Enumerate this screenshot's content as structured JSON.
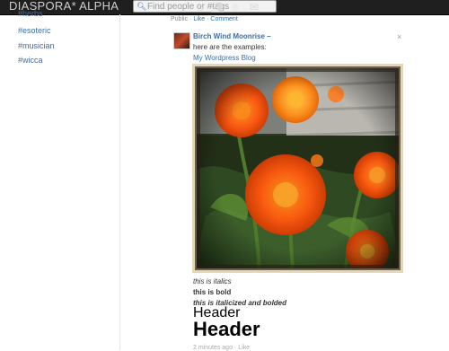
{
  "header": {
    "brand": "DIASPORA* ALPHA",
    "search_placeholder": "Find people or #tags",
    "icons": [
      "home-icon",
      "contacts-icon",
      "world-icon",
      "mail-icon"
    ]
  },
  "sidebar": {
    "tags": [
      {
        "label": "#herbs"
      },
      {
        "label": "#esoteric"
      },
      {
        "label": "#musician"
      },
      {
        "label": "#wicca"
      }
    ]
  },
  "post": {
    "top_meta": {
      "visibility": "Public",
      "sep": "·",
      "like": "Like",
      "comment": "Comment"
    },
    "author": "Birch Wind Moonrise",
    "author_suffix": "–",
    "close": "×",
    "text1": "here are the examples:",
    "link1": "My Wordpress Blog",
    "italic": "this is italics",
    "bold": "this is bold",
    "bolditalic": "this is italicized and bolded",
    "header1": "Header",
    "header2": "Header",
    "bottom_meta": "2 minutes ago · Like"
  }
}
